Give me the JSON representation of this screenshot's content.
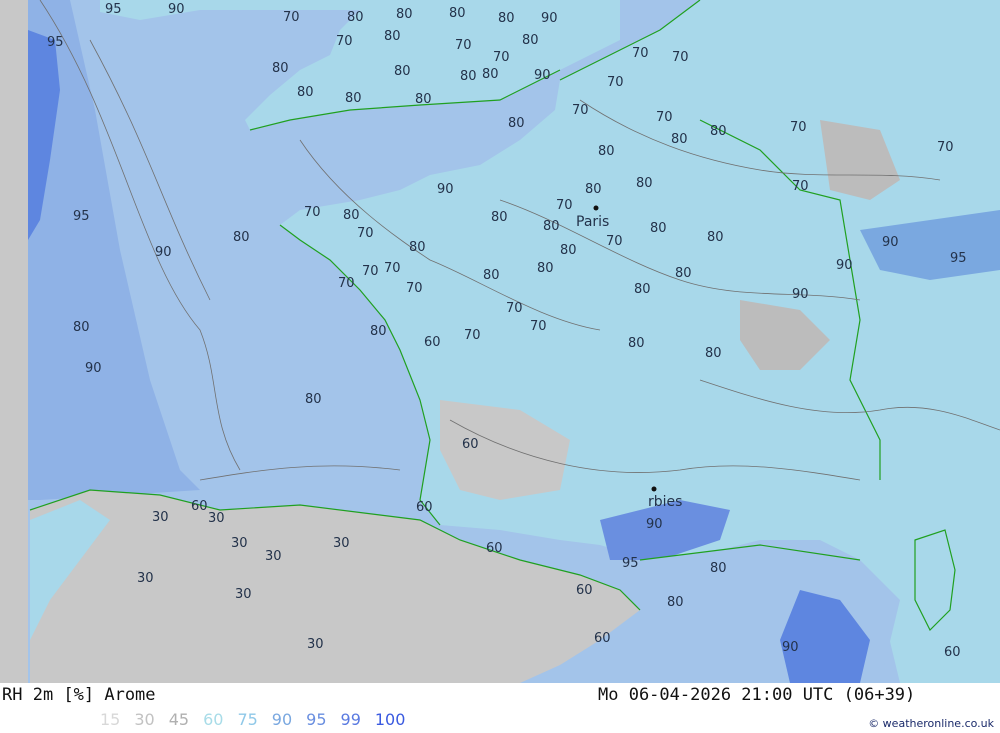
{
  "header": {
    "title": "RH 2m [%] Arome",
    "datetime": "Mo 06-04-2026 21:00 UTC (06+39)"
  },
  "legend": {
    "values": [
      "15",
      "30",
      "45",
      "60",
      "75",
      "90",
      "95",
      "99",
      "100"
    ],
    "colors": [
      "#d8d8d8",
      "#c2c2c2",
      "#b0b0b0",
      "#a8dce8",
      "#8fc8e8",
      "#7aa8e0",
      "#6a8fe0",
      "#5a7ae0",
      "#3a5ae0"
    ]
  },
  "credit": "© weatheronline.co.uk",
  "cities": [
    "Paris",
    "rbies"
  ],
  "contour_labels": [
    "95",
    "90",
    "70",
    "80",
    "80",
    "80",
    "80",
    "90",
    "95",
    "70",
    "80",
    "80",
    "70",
    "80",
    "80",
    "70",
    "80",
    "80",
    "90",
    "80",
    "80",
    "70",
    "70",
    "70",
    "80",
    "70",
    "70",
    "80",
    "80",
    "80",
    "70",
    "80",
    "70",
    "95",
    "90",
    "80",
    "70",
    "80",
    "70",
    "80",
    "70",
    "80",
    "80",
    "90",
    "80",
    "80",
    "70",
    "80",
    "80",
    "70",
    "80",
    "90",
    "90",
    "70",
    "80",
    "70",
    "80",
    "80",
    "70",
    "70",
    "80",
    "70",
    "80",
    "70",
    "90",
    "80",
    "80",
    "95",
    "70",
    "90",
    "80",
    "60",
    "30",
    "30",
    "30",
    "60",
    "80",
    "30",
    "60",
    "30",
    "30",
    "30",
    "60",
    "60",
    "60",
    "60",
    "90",
    "95",
    "80",
    "90",
    "80",
    "30",
    "60"
  ],
  "colors": {
    "sea": "#a3c4ea",
    "humid_land": "#a8d8ea",
    "dry_land": "#c8c8c8",
    "very_humid": "#5e86e0",
    "contour": "#707070",
    "border": "#20a020",
    "label": "#23324a"
  }
}
